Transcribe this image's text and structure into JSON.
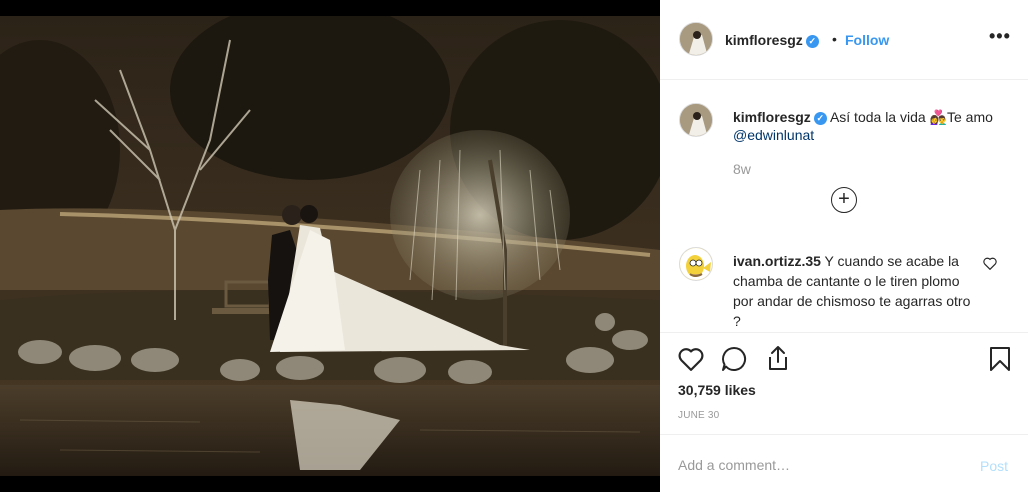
{
  "post": {
    "author": "kimfloresgz",
    "follow_label": "Follow",
    "separator": "•",
    "more_label": "•••",
    "caption": {
      "username": "kimfloresgz",
      "text": "Así toda la vida 👩‍❤️‍👨Te amo ",
      "mention": "@edwinlunat",
      "time": "8w"
    },
    "load_more_icon": "plus-circle-icon",
    "comments": [
      {
        "username": "ivan.ortizz.35",
        "text": " Y cuando se acabe la chamba de cantante o le tiren plomo por andar de chismoso te agarras otro ?"
      }
    ],
    "likes": "30,759 likes",
    "date": "June 30",
    "add_comment_placeholder": "Add a comment…",
    "post_label": "Post"
  },
  "colors": {
    "accent": "#3897f0",
    "post_disabled": "#b2dffc",
    "muted": "#999999"
  },
  "icons": [
    "heart-icon",
    "comment-icon",
    "share-icon",
    "bookmark-icon",
    "verified-icon",
    "more-icon"
  ]
}
